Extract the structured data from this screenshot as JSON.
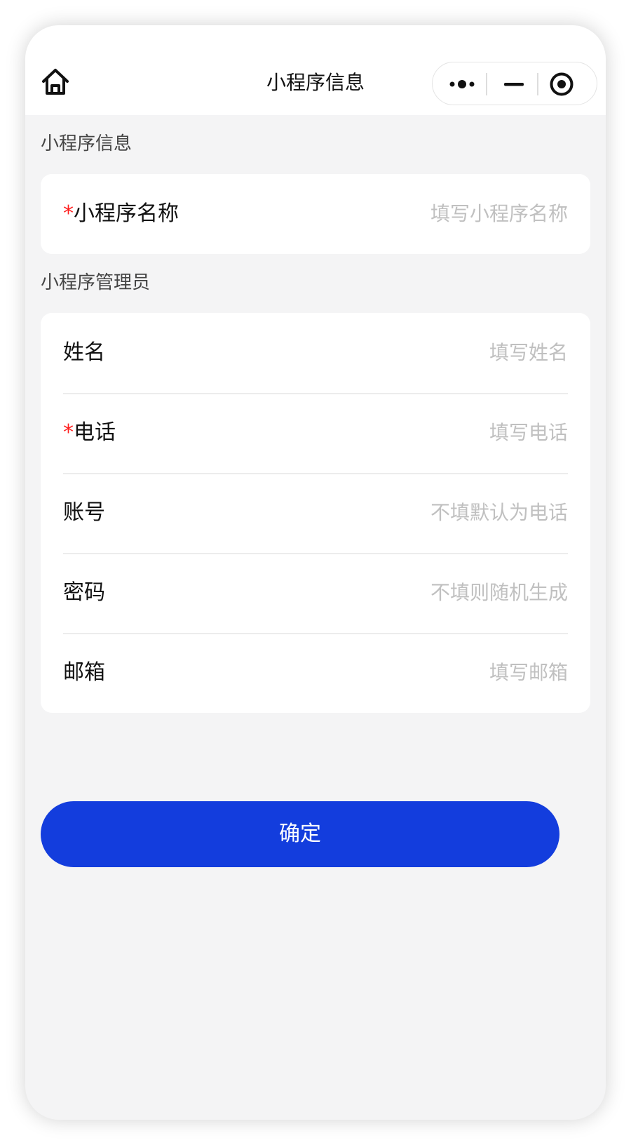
{
  "nav": {
    "title": "小程序信息",
    "home_icon": "home-icon",
    "more_icon": "more-dots-icon",
    "minimize_icon": "minimize-icon",
    "close_icon": "target-circle-icon"
  },
  "section1": {
    "title": "小程序信息",
    "fields": [
      {
        "required": "*",
        "label": "小程序名称",
        "value": "",
        "placeholder": "填写小程序名称"
      }
    ]
  },
  "section2": {
    "title": "小程序管理员",
    "fields": [
      {
        "required": "",
        "label": "姓名",
        "value": "",
        "placeholder": "填写姓名"
      },
      {
        "required": "*",
        "label": "电话",
        "value": "",
        "placeholder": "填写电话"
      },
      {
        "required": "",
        "label": "账号",
        "value": "",
        "placeholder": "不填默认为电话"
      },
      {
        "required": "",
        "label": "密码",
        "value": "",
        "placeholder": "不填则随机生成"
      },
      {
        "required": "",
        "label": "邮箱",
        "value": "",
        "placeholder": "填写邮箱"
      }
    ]
  },
  "actions": {
    "confirm_label": "确定"
  },
  "colors": {
    "primary": "#133ddd",
    "required": "#ff1f1f",
    "placeholder": "#c0c0c0",
    "background": "#f4f4f5"
  }
}
